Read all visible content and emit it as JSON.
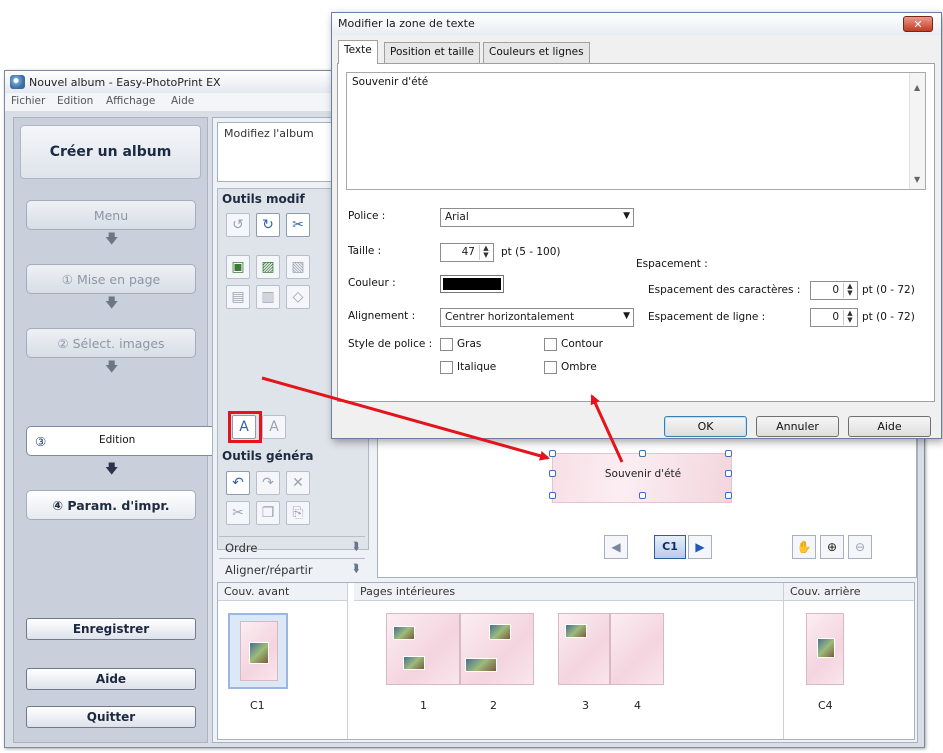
{
  "main_window": {
    "title": "Nouvel album - Easy-PhotoPrint EX",
    "menu": [
      "Fichier",
      "Edition",
      "Affichage",
      "Aide"
    ]
  },
  "nav": {
    "title": "Créer un album",
    "menu": "Menu",
    "step1": "① Mise en page",
    "step2": "② Sélect. images",
    "step3_num": "③",
    "step3": "Edition",
    "step4": "④ Param. d'impr.",
    "save": "Enregistrer",
    "help": "Aide",
    "quit": "Quitter"
  },
  "content": {
    "guide": "Modifiez l'album",
    "tools_header": "Outils modif",
    "general_header": "Outils généra",
    "order": "Ordre",
    "align": "Aligner/répartir",
    "cover_text": "Souvenir d'été",
    "page_indicator": "C1"
  },
  "strip": {
    "front_header": "Couv. avant",
    "inner_header": "Pages intérieures",
    "back_header": "Couv. arrière",
    "front_label": "C1",
    "p1": "1",
    "p2": "2",
    "p3": "3",
    "p4": "4",
    "back_label": "C4"
  },
  "dialog": {
    "title": "Modifier la zone de texte",
    "tabs": [
      "Texte",
      "Position et taille",
      "Couleurs et lignes"
    ],
    "text_value": "Souvenir d'été",
    "font_label": "Police :",
    "font_value": "Arial",
    "size_label": "Taille :",
    "size_value": "47",
    "size_range": "pt (5 - 100)",
    "color_label": "Couleur :",
    "color_value": "#000000",
    "align_label": "Alignement :",
    "align_value": "Centrer horizontalement",
    "style_label": "Style de police :",
    "bold": "Gras",
    "italic": "Italique",
    "outline": "Contour",
    "shadow": "Ombre",
    "spacing_label": "Espacement :",
    "char_spacing_label": "Espacement des caractères :",
    "char_spacing_value": "0",
    "char_spacing_range": "pt (0 - 72)",
    "line_spacing_label": "Espacement de ligne :",
    "line_spacing_value": "0",
    "line_spacing_range": "pt (0 - 72)",
    "ok": "OK",
    "cancel": "Annuler",
    "help": "Aide"
  },
  "colors": {
    "callout": "#e3141b",
    "active_tab": "#1f3f7a"
  }
}
